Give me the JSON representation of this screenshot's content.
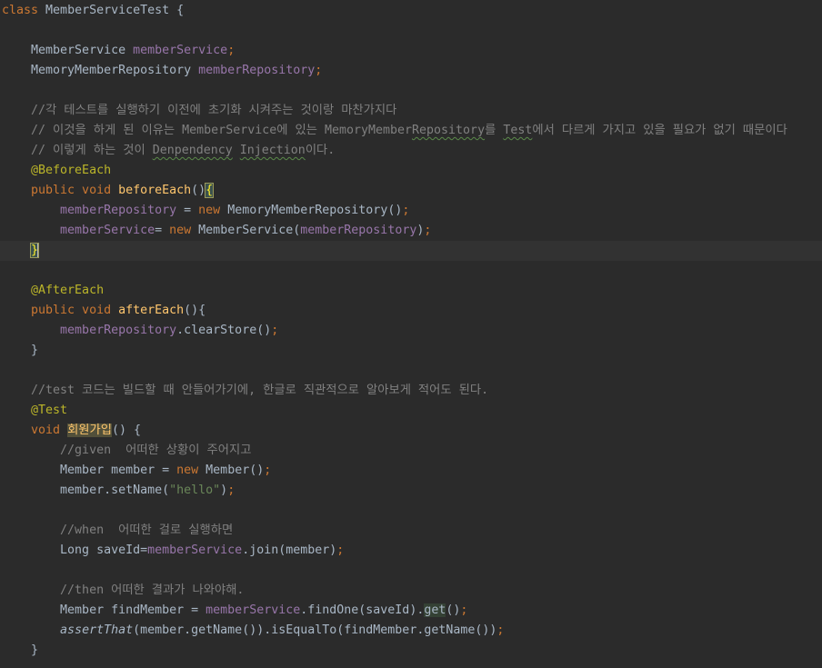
{
  "editor": {
    "lines": [
      [
        {
          "t": "class ",
          "c": "kw"
        },
        {
          "t": "MemberServiceTest {",
          "c": "plain"
        }
      ],
      [],
      [
        {
          "t": "    MemberService ",
          "c": "plain"
        },
        {
          "t": "memberService",
          "c": "field"
        },
        {
          "t": ";",
          "c": "kw"
        }
      ],
      [
        {
          "t": "    MemoryMemberRepository ",
          "c": "plain"
        },
        {
          "t": "memberRepository",
          "c": "field"
        },
        {
          "t": ";",
          "c": "kw"
        }
      ],
      [],
      [
        {
          "t": "    //각 테스트를 실행하기 이전에 초기화 시켜주는 것이랑 마찬가지다",
          "c": "comment"
        }
      ],
      [
        {
          "t": "    // 이것을 하게 된 이유는 MemberService에 있는 MemoryMember",
          "c": "comment"
        },
        {
          "t": "Repository",
          "c": "comment typo"
        },
        {
          "t": "를 ",
          "c": "comment"
        },
        {
          "t": "Test",
          "c": "comment typo"
        },
        {
          "t": "에서 다르게 가지고 있을 필요가 없기 때문이다",
          "c": "comment"
        }
      ],
      [
        {
          "t": "    // 이렇게 하는 것이 ",
          "c": "comment"
        },
        {
          "t": "Denpendency",
          "c": "comment typo"
        },
        {
          "t": " ",
          "c": "comment"
        },
        {
          "t": "Injection",
          "c": "comment typo"
        },
        {
          "t": "이다.",
          "c": "comment"
        }
      ],
      [
        {
          "t": "    @BeforeEach",
          "c": "ann"
        }
      ],
      [
        {
          "t": "    public void ",
          "c": "kw"
        },
        {
          "t": "beforeEach",
          "c": "method"
        },
        {
          "t": "()",
          "c": "plain"
        },
        {
          "t": "{",
          "c": "brace"
        }
      ],
      [
        {
          "t": "        memberRepository",
          "c": "field"
        },
        {
          "t": " = ",
          "c": "plain"
        },
        {
          "t": "new ",
          "c": "kw"
        },
        {
          "t": "MemoryMemberRepository()",
          "c": "plain"
        },
        {
          "t": ";",
          "c": "kw"
        }
      ],
      [
        {
          "t": "        memberService",
          "c": "field"
        },
        {
          "t": "= ",
          "c": "plain"
        },
        {
          "t": "new ",
          "c": "kw"
        },
        {
          "t": "MemberService(",
          "c": "plain"
        },
        {
          "t": "memberRepository",
          "c": "field"
        },
        {
          "t": ")",
          "c": "plain"
        },
        {
          "t": ";",
          "c": "kw"
        }
      ],
      [
        {
          "t": "    ",
          "c": "plain"
        },
        {
          "t": "}",
          "c": "brace"
        },
        {
          "t": "",
          "c": "caret"
        }
      ],
      [],
      [
        {
          "t": "    @AfterEach",
          "c": "ann"
        }
      ],
      [
        {
          "t": "    public void ",
          "c": "kw"
        },
        {
          "t": "afterEach",
          "c": "method"
        },
        {
          "t": "(){",
          "c": "plain"
        }
      ],
      [
        {
          "t": "        memberRepository",
          "c": "field"
        },
        {
          "t": ".clearStore()",
          "c": "plain"
        },
        {
          "t": ";",
          "c": "kw"
        }
      ],
      [
        {
          "t": "    }",
          "c": "plain"
        }
      ],
      [],
      [
        {
          "t": "    //test 코드는 빌드할 때 안들어가기에, 한글로 직관적으로 알아보게 적어도 된다.",
          "c": "comment"
        }
      ],
      [
        {
          "t": "    @Test",
          "c": "ann"
        }
      ],
      [
        {
          "t": "    void ",
          "c": "kw"
        },
        {
          "t": "회원가입",
          "c": "method warn"
        },
        {
          "t": "() {",
          "c": "plain"
        }
      ],
      [
        {
          "t": "        //given  어떠한 상황이 주어지고",
          "c": "comment"
        }
      ],
      [
        {
          "t": "        Member member = ",
          "c": "plain"
        },
        {
          "t": "new ",
          "c": "kw"
        },
        {
          "t": "Member()",
          "c": "plain"
        },
        {
          "t": ";",
          "c": "kw"
        }
      ],
      [
        {
          "t": "        member.setName(",
          "c": "plain"
        },
        {
          "t": "\"hello\"",
          "c": "str"
        },
        {
          "t": ")",
          "c": "plain"
        },
        {
          "t": ";",
          "c": "kw"
        }
      ],
      [],
      [
        {
          "t": "        //when  어떠한 걸로 실행하면",
          "c": "comment"
        }
      ],
      [
        {
          "t": "        Long saveId=",
          "c": "plain"
        },
        {
          "t": "memberService",
          "c": "field"
        },
        {
          "t": ".join(member)",
          "c": "plain"
        },
        {
          "t": ";",
          "c": "kw"
        }
      ],
      [],
      [
        {
          "t": "        //then 어떠한 결과가 나와야해.",
          "c": "comment"
        }
      ],
      [
        {
          "t": "        Member findMember = ",
          "c": "plain"
        },
        {
          "t": "memberService",
          "c": "field"
        },
        {
          "t": ".findOne(saveId).",
          "c": "plain"
        },
        {
          "t": "get",
          "c": "plain gethl"
        },
        {
          "t": "()",
          "c": "plain"
        },
        {
          "t": ";",
          "c": "kw"
        }
      ],
      [
        {
          "t": "        ",
          "c": "plain"
        },
        {
          "t": "assertThat",
          "c": "plain ital"
        },
        {
          "t": "(member.getName()).isEqualTo(findMember.getName())",
          "c": "plain"
        },
        {
          "t": ";",
          "c": "kw"
        }
      ],
      [
        {
          "t": "    }",
          "c": "plain"
        }
      ]
    ],
    "caret_line_index": 12
  }
}
